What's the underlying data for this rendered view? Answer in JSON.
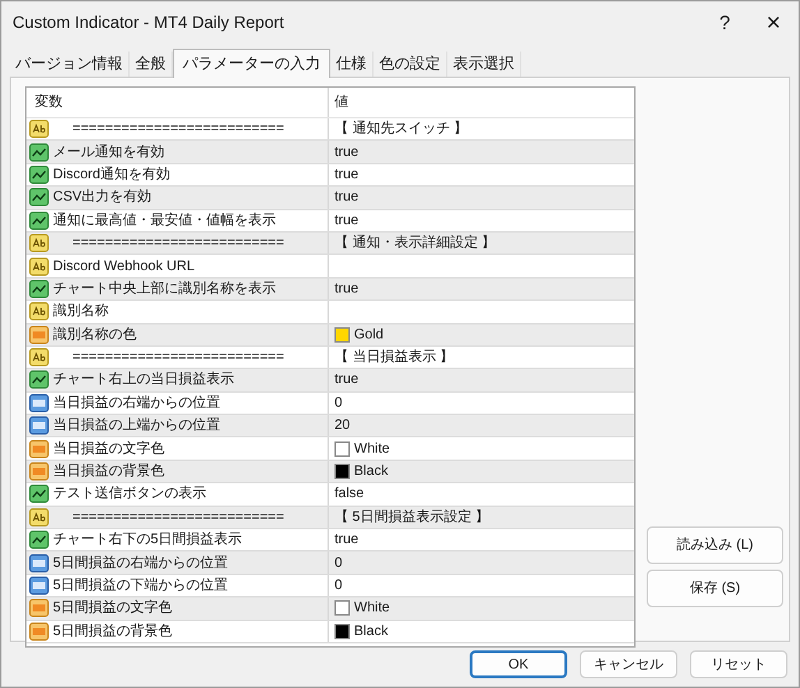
{
  "window": {
    "title": "Custom Indicator - MT4 Daily Report",
    "help": "?",
    "close": "×"
  },
  "tabs": [
    {
      "label": "バージョン情報",
      "selected": false
    },
    {
      "label": "全般",
      "selected": false
    },
    {
      "label": "パラメーターの入力",
      "selected": true
    },
    {
      "label": "仕様",
      "selected": false
    },
    {
      "label": "色の設定",
      "selected": false
    },
    {
      "label": "表示選択",
      "selected": false
    }
  ],
  "table": {
    "columns": [
      "変数",
      "値"
    ],
    "rows": [
      {
        "kind": "string",
        "name": "==========================",
        "value": "【 通知先スイッチ 】"
      },
      {
        "kind": "bool",
        "name": "メール通知を有効",
        "value": "true"
      },
      {
        "kind": "bool",
        "name": "Discord通知を有効",
        "value": "true"
      },
      {
        "kind": "bool",
        "name": "CSV出力を有効",
        "value": "true"
      },
      {
        "kind": "bool",
        "name": "通知に最高値・最安値・値幅を表示",
        "value": "true"
      },
      {
        "kind": "string",
        "name": "==========================",
        "value": "【 通知・表示詳細設定 】"
      },
      {
        "kind": "string",
        "name": "Discord Webhook URL"
      },
      {
        "kind": "bool",
        "name": "チャート中央上部に識別名称を表示",
        "value": "true"
      },
      {
        "kind": "string",
        "name": "識別名称"
      },
      {
        "kind": "color",
        "name": "識別名称の色",
        "value": "Gold",
        "color": "#ffd700"
      },
      {
        "kind": "string",
        "name": "==========================",
        "value": "【 当日損益表示 】"
      },
      {
        "kind": "bool",
        "name": "チャート右上の当日損益表示",
        "value": "true"
      },
      {
        "kind": "int",
        "name": "当日損益の右端からの位置",
        "value": "0"
      },
      {
        "kind": "int",
        "name": "当日損益の上端からの位置",
        "value": "20"
      },
      {
        "kind": "color",
        "name": "当日損益の文字色",
        "value": "White",
        "color": "#ffffff"
      },
      {
        "kind": "color",
        "name": "当日損益の背景色",
        "value": "Black",
        "color": "#000000"
      },
      {
        "kind": "bool",
        "name": "テスト送信ボタンの表示",
        "value": "false"
      },
      {
        "kind": "string",
        "name": "==========================",
        "value": "【 5日間損益表示設定 】"
      },
      {
        "kind": "bool",
        "name": "チャート右下の5日間損益表示",
        "value": "true"
      },
      {
        "kind": "int",
        "name": "5日間損益の右端からの位置",
        "value": "0"
      },
      {
        "kind": "int",
        "name": "5日間損益の下端からの位置",
        "value": "0"
      },
      {
        "kind": "color",
        "name": "5日間損益の文字色",
        "value": "White",
        "color": "#ffffff"
      },
      {
        "kind": "color",
        "name": "5日間損益の背景色",
        "value": "Black",
        "color": "#000000"
      }
    ]
  },
  "side_buttons": [
    "読み込み (L)",
    "保存 (S)"
  ],
  "buttons": [
    {
      "label": "OK",
      "default": true
    },
    {
      "label": "キャンセル",
      "default": false
    },
    {
      "label": "リセット",
      "default": false
    }
  ]
}
